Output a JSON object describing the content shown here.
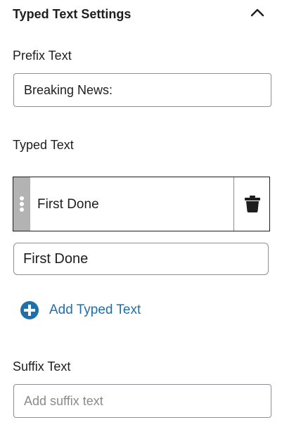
{
  "panel": {
    "title": "Typed Text Settings",
    "toggle_icon": "chevron-up-icon"
  },
  "prefix": {
    "label": "Prefix Text",
    "value": "Breaking News:"
  },
  "typed": {
    "label": "Typed Text",
    "items": [
      {
        "label": "First Done"
      }
    ],
    "edit_value": "First Done",
    "add_label": "Add Typed Text",
    "accent_color": "#1f6fa8"
  },
  "suffix": {
    "label": "Suffix Text",
    "value": "",
    "placeholder": "Add suffix text"
  }
}
